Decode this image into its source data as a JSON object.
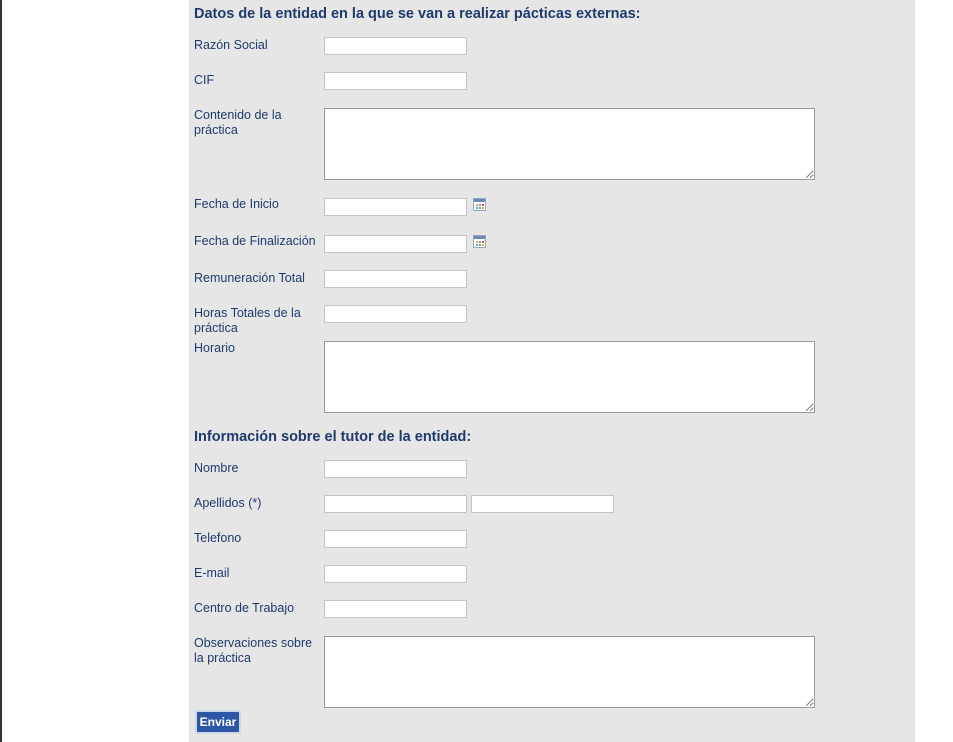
{
  "entity_section": {
    "title": "Datos de la entidad en la que se van a realizar pácticas externas:",
    "fields": {
      "razon_social": {
        "label": "Razón Social",
        "value": ""
      },
      "cif": {
        "label": "CIF",
        "value": ""
      },
      "contenido": {
        "label": "Contenido de la práctica",
        "value": ""
      },
      "fecha_inicio": {
        "label": "Fecha de Inicio",
        "value": ""
      },
      "fecha_fin": {
        "label": "Fecha de Finalización",
        "value": ""
      },
      "remuneracion": {
        "label": "Remuneración Total",
        "value": ""
      },
      "horas": {
        "label": "Horas Totales de la práctica",
        "value": ""
      },
      "horario": {
        "label": "Horario",
        "value": ""
      }
    }
  },
  "tutor_section": {
    "title": "Información sobre el tutor de la entidad:",
    "fields": {
      "nombre": {
        "label": "Nombre",
        "value": ""
      },
      "apellidos": {
        "label": "Apellidos (*)",
        "value1": "",
        "value2": ""
      },
      "telefono": {
        "label": "Telefono",
        "value": ""
      },
      "email": {
        "label": "E-mail",
        "value": ""
      },
      "centro": {
        "label": "Centro de Trabajo",
        "value": ""
      },
      "observaciones": {
        "label": "Observaciones sobre la práctica",
        "value": ""
      }
    }
  },
  "submit_label": "Enviar",
  "icons": {
    "date_picker": "calendar-icon"
  },
  "colors": {
    "label_text": "#1f3a6d",
    "panel_bg": "#e6e6e6",
    "button_bg": "#2b57a6"
  }
}
